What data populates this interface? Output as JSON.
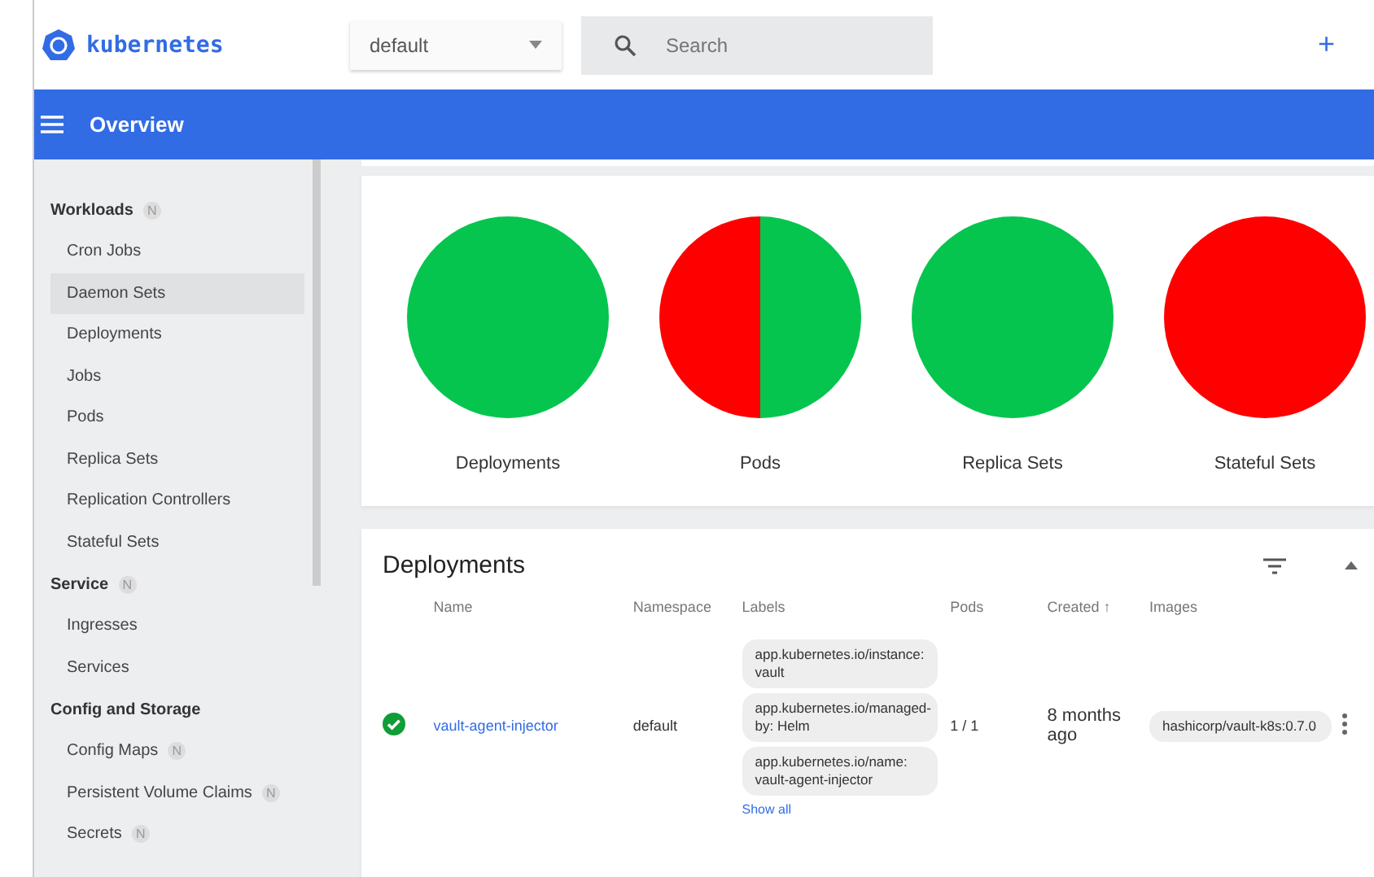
{
  "header": {
    "logo_text": "kubernetes",
    "namespace_select": {
      "value": "default"
    },
    "search": {
      "placeholder": "Search"
    },
    "add_button": "+"
  },
  "toolbar": {
    "title": "Overview"
  },
  "sidebar": {
    "sections": [
      {
        "title": "Workloads",
        "badge": "N",
        "items": [
          {
            "label": "Cron Jobs",
            "selected": false
          },
          {
            "label": "Daemon Sets",
            "selected": true
          },
          {
            "label": "Deployments",
            "selected": false
          },
          {
            "label": "Jobs",
            "selected": false
          },
          {
            "label": "Pods",
            "selected": false
          },
          {
            "label": "Replica Sets",
            "selected": false
          },
          {
            "label": "Replication Controllers",
            "selected": false
          },
          {
            "label": "Stateful Sets",
            "selected": false
          }
        ]
      },
      {
        "title": "Service",
        "badge": "N",
        "items": [
          {
            "label": "Ingresses",
            "selected": false
          },
          {
            "label": "Services",
            "selected": false
          }
        ]
      },
      {
        "title": "Config and Storage",
        "items": [
          {
            "label": "Config Maps",
            "badge": "N",
            "selected": false
          },
          {
            "label": "Persistent Volume Claims",
            "badge": "N",
            "selected": false
          },
          {
            "label": "Secrets",
            "badge": "N",
            "selected": false
          }
        ]
      }
    ]
  },
  "status_charts": [
    {
      "label": "Deployments",
      "kind": "running"
    },
    {
      "label": "Pods",
      "kind": "mixed"
    },
    {
      "label": "Replica Sets",
      "kind": "running"
    },
    {
      "label": "Stateful Sets",
      "kind": "failed"
    }
  ],
  "deployments": {
    "title": "Deployments",
    "columns": [
      "Name",
      "Namespace",
      "Labels",
      "Pods",
      "Created ↑",
      "Images"
    ],
    "rows": [
      {
        "healthy": true,
        "name": "vault-agent-injector",
        "namespace": "default",
        "labels": [
          "app.kubernetes.io/instance: vault",
          "app.kubernetes.io/managed-by: Helm",
          "app.kubernetes.io/name: vault-agent-injector"
        ],
        "show_all": "Show all",
        "pods": "1 / 1",
        "created": "8 months ago",
        "images": [
          "hashicorp/vault-k8s:0.7.0"
        ]
      }
    ]
  }
}
